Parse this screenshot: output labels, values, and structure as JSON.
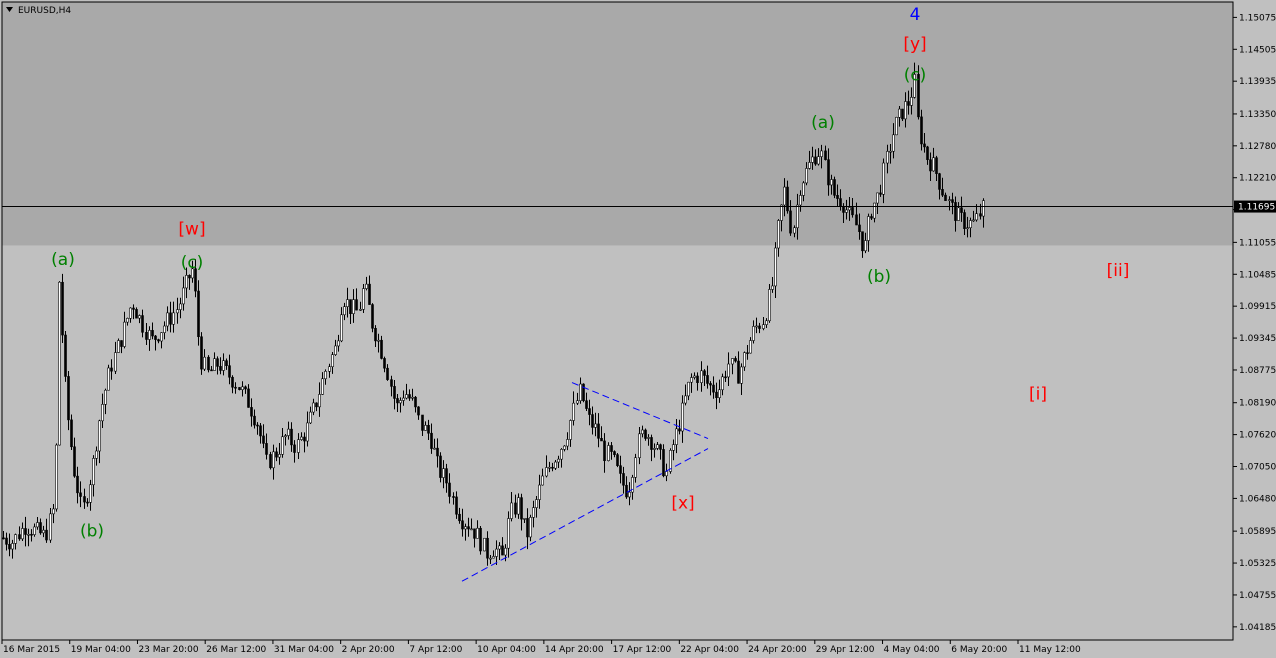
{
  "window": {
    "title": "EURUSD,H4",
    "menu_icon": "triangle-down-icon"
  },
  "chart_data": {
    "type": "candlestick",
    "symbol": "EURUSD",
    "timeframe": "H4",
    "ylim": [
      1.0395,
      1.1535
    ],
    "y_ticks": [
      "1.15075",
      "1.14505",
      "1.13935",
      "1.13350",
      "1.12780",
      "1.12210",
      "1.11640",
      "1.11055",
      "1.10485",
      "1.09915",
      "1.09345",
      "1.08775",
      "1.08190",
      "1.07620",
      "1.07050",
      "1.06480",
      "1.05895",
      "1.05325",
      "1.04755",
      "1.04185"
    ],
    "x_ticks": [
      "16 Mar 2015",
      "19 Mar 04:00",
      "23 Mar 20:00",
      "26 Mar 12:00",
      "31 Mar 04:00",
      "2 Apr 20:00",
      "7 Apr 12:00",
      "10 Apr 04:00",
      "14 Apr 20:00",
      "17 Apr 12:00",
      "22 Apr 04:00",
      "24 Apr 20:00",
      "29 Apr 12:00",
      "4 May 04:00",
      "6 May 20:00",
      "11 May 12:00"
    ],
    "current_price": "1.11695",
    "resistance_zone": [
      1.11,
      1.1535
    ],
    "price_path": [
      [
        0,
        1.058
      ],
      [
        12,
        1.057
      ],
      [
        25,
        1.06
      ],
      [
        45,
        1.058
      ],
      [
        55,
        1.064
      ],
      [
        58,
        1.106
      ],
      [
        66,
        1.082
      ],
      [
        74,
        1.07
      ],
      [
        82,
        1.062
      ],
      [
        92,
        1.07
      ],
      [
        100,
        1.08
      ],
      [
        110,
        1.088
      ],
      [
        122,
        1.094
      ],
      [
        132,
        1.1
      ],
      [
        142,
        1.096
      ],
      [
        152,
        1.093
      ],
      [
        165,
        1.096
      ],
      [
        178,
        1.099
      ],
      [
        188,
        1.104
      ],
      [
        193,
        1.106
      ],
      [
        200,
        1.09
      ],
      [
        208,
        1.087
      ],
      [
        218,
        1.089
      ],
      [
        228,
        1.087
      ],
      [
        238,
        1.085
      ],
      [
        248,
        1.082
      ],
      [
        258,
        1.078
      ],
      [
        266,
        1.071
      ],
      [
        276,
        1.073
      ],
      [
        286,
        1.076
      ],
      [
        296,
        1.074
      ],
      [
        306,
        1.077
      ],
      [
        316,
        1.082
      ],
      [
        326,
        1.088
      ],
      [
        336,
        1.092
      ],
      [
        342,
        1.101
      ],
      [
        350,
        1.099
      ],
      [
        358,
        1.098
      ],
      [
        364,
        1.103
      ],
      [
        372,
        1.096
      ],
      [
        380,
        1.092
      ],
      [
        388,
        1.087
      ],
      [
        396,
        1.081
      ],
      [
        404,
        1.084
      ],
      [
        412,
        1.082
      ],
      [
        420,
        1.078
      ],
      [
        430,
        1.076
      ],
      [
        438,
        1.07
      ],
      [
        446,
        1.068
      ],
      [
        454,
        1.064
      ],
      [
        462,
        1.061
      ],
      [
        470,
        1.06
      ],
      [
        478,
        1.058
      ],
      [
        486,
        1.055
      ],
      [
        494,
        1.056
      ],
      [
        502,
        1.054
      ],
      [
        510,
        1.062
      ],
      [
        518,
        1.064
      ],
      [
        526,
        1.058
      ],
      [
        534,
        1.063
      ],
      [
        542,
        1.068
      ],
      [
        550,
        1.071
      ],
      [
        558,
        1.073
      ],
      [
        566,
        1.076
      ],
      [
        574,
        1.081
      ],
      [
        580,
        1.084
      ],
      [
        588,
        1.079
      ],
      [
        596,
        1.077
      ],
      [
        604,
        1.073
      ],
      [
        612,
        1.072
      ],
      [
        620,
        1.068
      ],
      [
        628,
        1.066
      ],
      [
        636,
        1.074
      ],
      [
        644,
        1.077
      ],
      [
        652,
        1.075
      ],
      [
        660,
        1.072
      ],
      [
        666,
        1.069
      ],
      [
        672,
        1.074
      ],
      [
        680,
        1.079
      ],
      [
        690,
        1.086
      ],
      [
        700,
        1.087
      ],
      [
        708,
        1.085
      ],
      [
        718,
        1.084
      ],
      [
        728,
        1.089
      ],
      [
        738,
        1.087
      ],
      [
        746,
        1.091
      ],
      [
        754,
        1.095
      ],
      [
        764,
        1.097
      ],
      [
        772,
        1.103
      ],
      [
        778,
        1.113
      ],
      [
        784,
        1.12
      ],
      [
        792,
        1.112
      ],
      [
        800,
        1.121
      ],
      [
        808,
        1.124
      ],
      [
        814,
        1.126
      ],
      [
        820,
        1.127
      ],
      [
        826,
        1.123
      ],
      [
        834,
        1.119
      ],
      [
        842,
        1.118
      ],
      [
        850,
        1.115
      ],
      [
        858,
        1.113
      ],
      [
        864,
        1.109
      ],
      [
        870,
        1.116
      ],
      [
        878,
        1.119
      ],
      [
        886,
        1.125
      ],
      [
        894,
        1.131
      ],
      [
        902,
        1.134
      ],
      [
        910,
        1.136
      ],
      [
        914,
        1.14
      ],
      [
        918,
        1.131
      ],
      [
        926,
        1.126
      ],
      [
        934,
        1.124
      ],
      [
        942,
        1.12
      ],
      [
        950,
        1.117
      ],
      [
        958,
        1.115
      ],
      [
        966,
        1.114
      ],
      [
        974,
        1.114
      ],
      [
        984,
        1.117
      ]
    ],
    "annotations": [
      {
        "text": "(a)",
        "color": "green",
        "x": 0,
        "price": 1.1065
      },
      {
        "text": "(b)",
        "color": "green",
        "x": 1,
        "price": 1.058
      },
      {
        "text": "[w]",
        "color": "red",
        "x": 2,
        "price": 1.112
      },
      {
        "text": "(c)",
        "color": "green",
        "x": 2,
        "price": 1.106
      },
      {
        "text": "[x]",
        "color": "red",
        "x": 3,
        "price": 1.063
      },
      {
        "text": "(a)",
        "color": "green",
        "x": 4,
        "price": 1.131
      },
      {
        "text": "(b)",
        "color": "green",
        "x": 5,
        "price": 1.1035
      },
      {
        "text": "4",
        "color": "blue",
        "x": 6,
        "price": 1.1503
      },
      {
        "text": "[y]",
        "color": "red",
        "x": 6,
        "price": 1.145
      },
      {
        "text": "(c)",
        "color": "green",
        "x": 6,
        "price": 1.1395
      },
      {
        "text": "[ii]",
        "color": "red",
        "x": 7,
        "price": 1.1045
      },
      {
        "text": "[i]",
        "color": "red",
        "x": 8,
        "price": 1.0825
      }
    ],
    "triangle_lines": [
      {
        "from": [
          462,
          1.05
        ],
        "to": [
          708,
          1.0737
        ]
      },
      {
        "from": [
          572,
          1.0855
        ],
        "to": [
          708,
          1.0755
        ]
      }
    ]
  }
}
